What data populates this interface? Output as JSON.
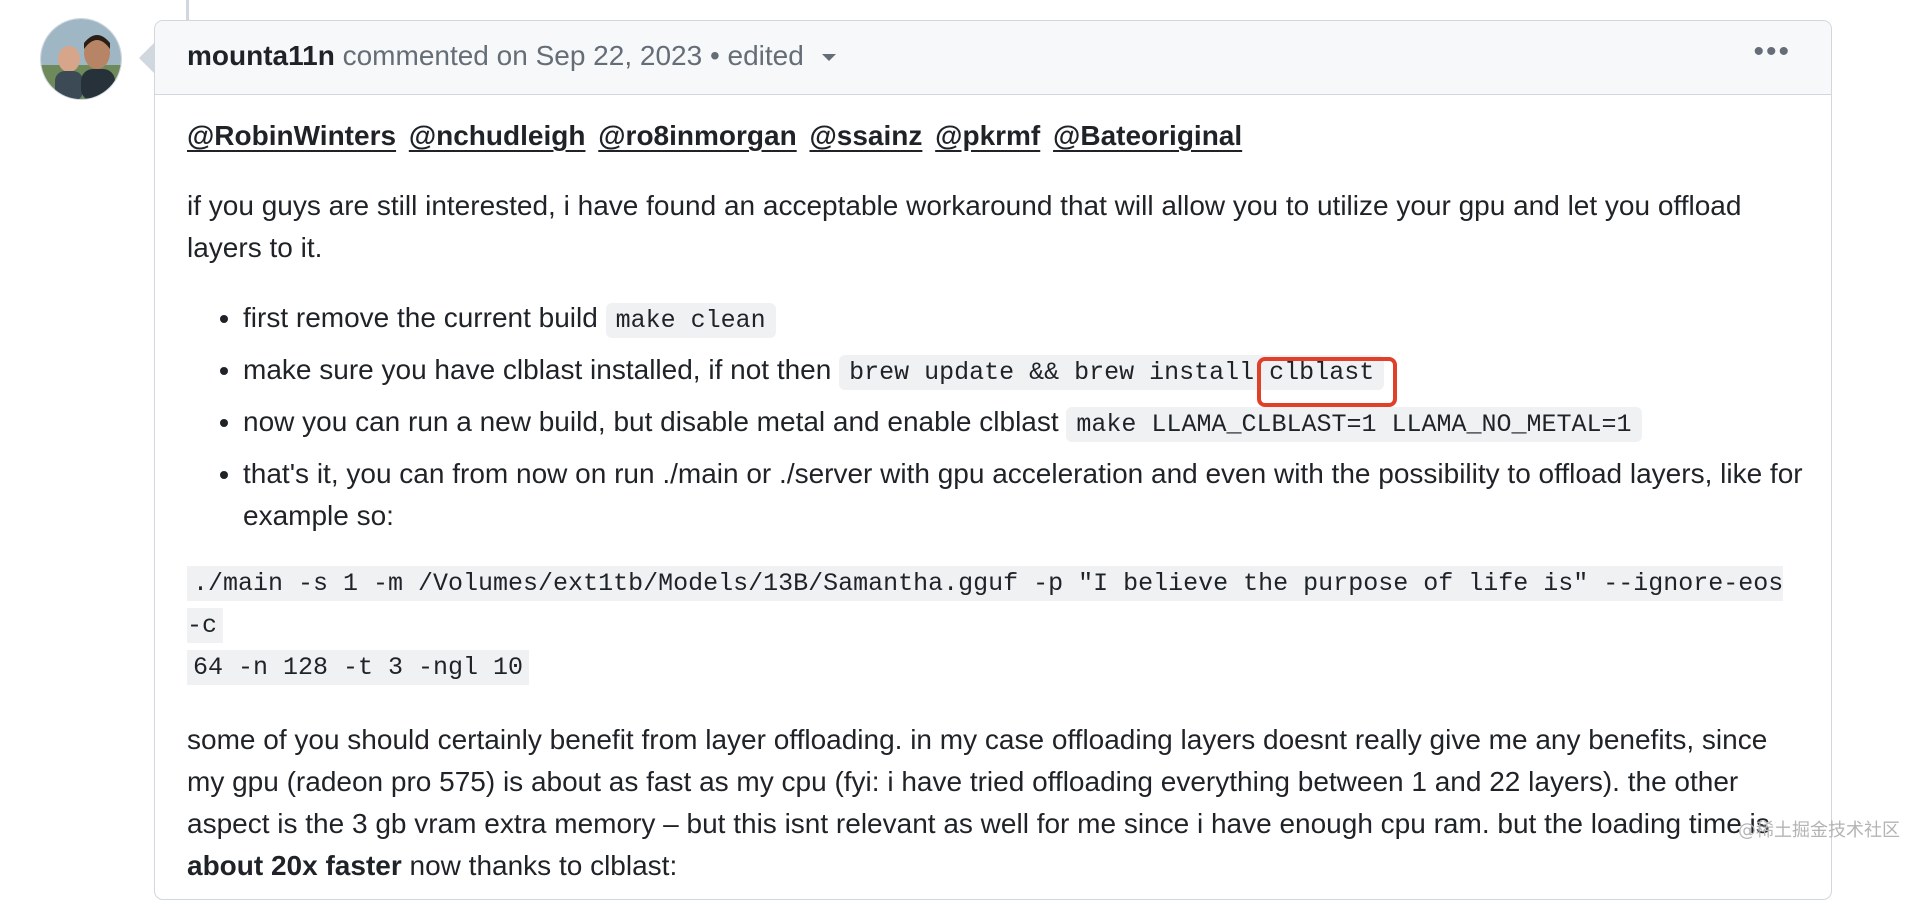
{
  "header": {
    "author": "mounta11n",
    "meta": "commented on Sep 22, 2023 • edited",
    "more_icon": "kebab-horizontal-icon"
  },
  "mentions": [
    "@RobinWinters",
    "@nchudleigh",
    "@ro8inmorgan",
    "@ssainz",
    "@pkrmf",
    "@Bateoriginal"
  ],
  "intro": "if you guys are still interested, i have found an acceptable workaround that will allow you to utilize your gpu and let you offload layers to it.",
  "steps": [
    {
      "text": "first remove the current build ",
      "code": "make clean"
    },
    {
      "text": "make sure you have clblast installed, if not then ",
      "code": "brew update && brew install clblast"
    },
    {
      "text": "now you can run a new build, but disable metal and enable clblast ",
      "code": "make LLAMA_CLBLAST=1 LLAMA_NO_METAL=1"
    },
    {
      "text": "that's it, you can from now on run ./main or ./server with gpu acceleration and even with the possibility to offload layers, like for example so:",
      "code": ""
    }
  ],
  "code_block": {
    "line1": "./main -s 1 -m /Volumes/ext1tb/Models/13B/Samantha.gguf -p \"I believe the purpose of life is\" --ignore-eos -c",
    "line2": "64 -n 128 -t 3 -ngl 10"
  },
  "outro": {
    "text": "some of you should certainly benefit from layer offloading. in my case offloading layers doesnt really give me any benefits, since my gpu (radeon pro 575) is about as fast as my cpu (fyi: i have tried offloading everything between 1 and 22 layers). the other aspect is the 3 gb vram extra memory – but this isnt relevant as well for me since i have enough cpu ram. but the loading time is ",
    "bold": "about 20x faster",
    "tail": " now thanks to clblast:"
  },
  "watermark": "@稀土掘金技术社区",
  "colors": {
    "highlight": "#e0402a",
    "border": "#d0d7de",
    "header_bg": "#f6f8fa"
  }
}
